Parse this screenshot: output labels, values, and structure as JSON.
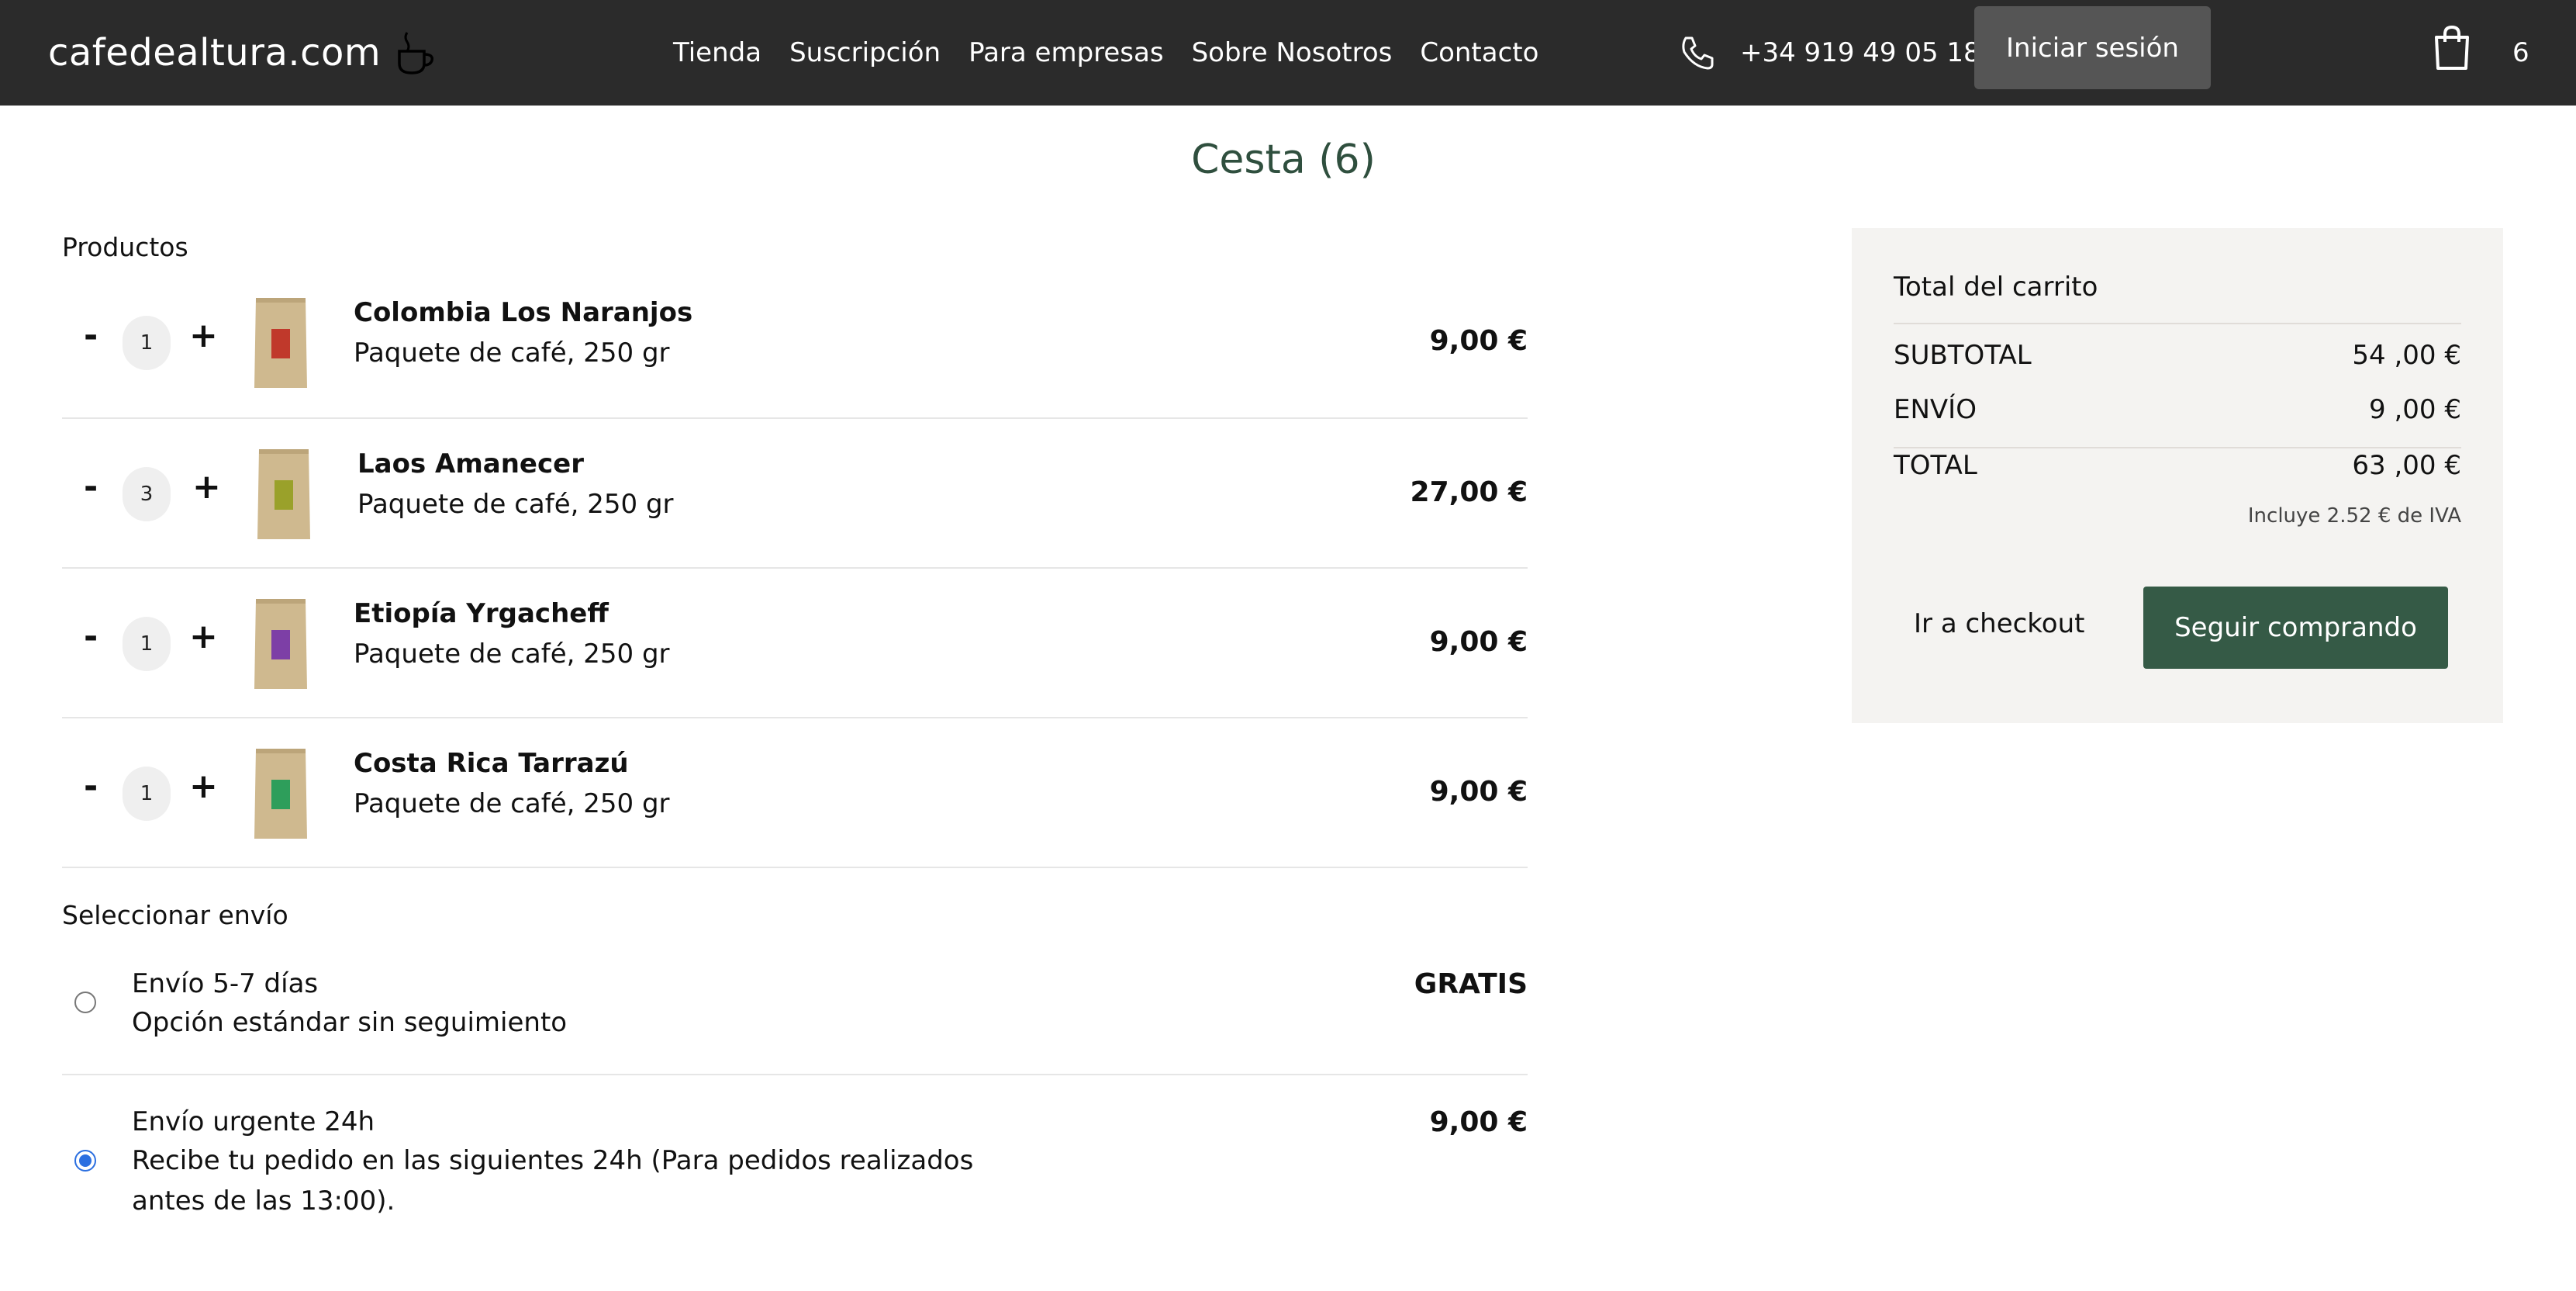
{
  "header": {
    "logo_text": "cafedealtura.com",
    "logo_icon": "coffee-cup-icon",
    "nav": [
      "Tienda",
      "Suscripción",
      "Para empresas",
      "Sobre Nosotros",
      "Contacto"
    ],
    "phone": "+34 919 49 05 18",
    "phone_icon": "phone-icon",
    "login_label": "Iniciar sesión",
    "bag_icon": "shopping-bag-icon",
    "bag_count": "6"
  },
  "page": {
    "title": "Cesta (6)"
  },
  "products_section": {
    "label": "Productos",
    "items": [
      {
        "name": "Colombia Los Naranjos",
        "description": "Paquete de café, 250 gr",
        "quantity": "1",
        "price": "9,00 €",
        "label_color": "#c0392b"
      },
      {
        "name": "Laos Amanecer",
        "description": "Paquete de café, 250 gr",
        "quantity": "3",
        "price": "27,00 €",
        "label_color": "#9aa12a"
      },
      {
        "name": "Etiopía Yrgacheff",
        "description": "Paquete de café, 250 gr",
        "quantity": "1",
        "price": "9,00 €",
        "label_color": "#7d3fa6"
      },
      {
        "name": "Costa Rica Tarrazú",
        "description": "Paquete de café, 250 gr",
        "quantity": "1",
        "price": "9,00 €",
        "label_color": "#2e9e5b"
      }
    ],
    "minus_label": "-",
    "plus_label": "+"
  },
  "shipping": {
    "label": "Seleccionar envío",
    "options": [
      {
        "title": "Envío 5-7 días",
        "description": "Opción estándar sin seguimiento",
        "price": "GRATIS",
        "selected": false
      },
      {
        "title": "Envío urgente 24h",
        "description": "Recibe tu pedido en las siguientes 24h (Para pedidos realizados antes de las 13:00).",
        "price": "9,00 €",
        "selected": true
      }
    ]
  },
  "summary": {
    "title": "Total del carrito",
    "subtotal_label": "SUBTOTAL",
    "subtotal_value": "54 ,00 €",
    "shipping_label": "ENVÍO",
    "shipping_value": "9 ,00 €",
    "total_label": "TOTAL",
    "total_value": "63 ,00 €",
    "vat_note": "Incluye 2.52 € de IVA",
    "checkout_label": "Ir a checkout",
    "continue_label": "Seguir comprando"
  },
  "colors": {
    "header_bg": "#2b2b2b",
    "accent_green": "#355a46",
    "summary_bg": "#f4f3f1",
    "radio_selected": "#2b6fe0"
  }
}
